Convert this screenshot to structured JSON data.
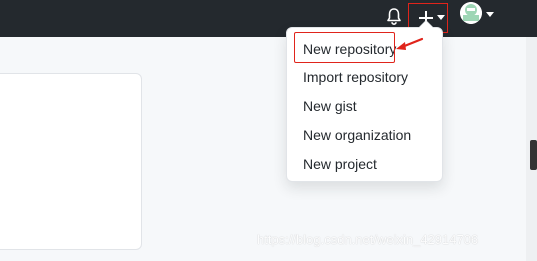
{
  "header": {
    "icons": [
      "bell-icon",
      "plus-icon",
      "chevron-down-icon",
      "avatar"
    ],
    "background": "#24292e"
  },
  "create_menu": {
    "items": [
      {
        "label": "New repository"
      },
      {
        "label": "Import repository"
      },
      {
        "label": "New gist"
      },
      {
        "label": "New organization"
      },
      {
        "label": "New project"
      }
    ]
  },
  "annotation": {
    "color": "#e0241b"
  },
  "watermark": {
    "text": "https://blog.csdn.net/weixin_42914706"
  }
}
